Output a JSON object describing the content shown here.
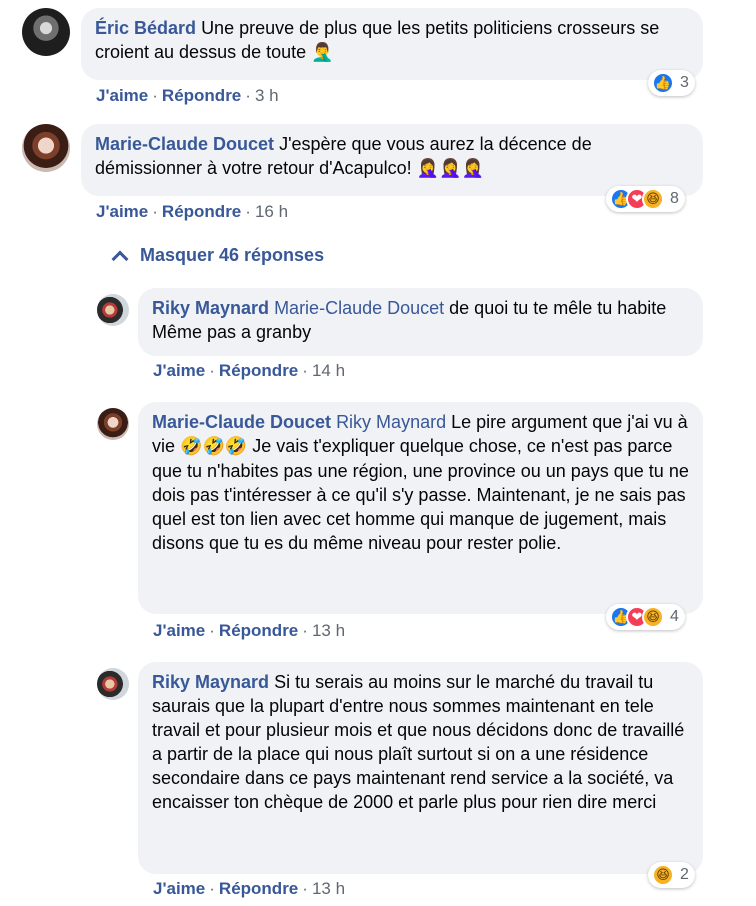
{
  "comments": [
    {
      "author": "Éric Bédard",
      "text": "Une preuve de plus que les petits politiciens crosseurs se croient au dessus de toute",
      "emoji": "🤦‍♂️",
      "like_label": "J'aime",
      "reply_label": "Répondre",
      "time": "3 h",
      "reaction_count": "3"
    },
    {
      "author": "Marie-Claude Doucet",
      "text": "J'espère que vous aurez la décence de démissionner à votre retour d'Acapulco!",
      "emoji": "🤦‍♀️🤦‍♀️🤦‍♀️",
      "like_label": "J'aime",
      "reply_label": "Répondre",
      "time": "16 h",
      "reaction_count": "8"
    }
  ],
  "replies_toggle": "Masquer 46 réponses",
  "replies": [
    {
      "author": "Riky Maynard",
      "mention": "Marie-Claude Doucet",
      "text": "de quoi tu te mêle tu habite Même pas a granby",
      "like_label": "J'aime",
      "reply_label": "Répondre",
      "time": "14 h"
    },
    {
      "author": "Marie-Claude Doucet",
      "mention": "Riky Maynard",
      "text_a": "Le pire argument que j'ai vu à vie",
      "emoji": "🤣🤣🤣",
      "text_b": "Je vais t'expliquer quelque chose, ce n'est pas parce que tu n'habites pas une région, une province ou un pays que tu ne dois pas t'intéresser à ce qu'il s'y passe. Maintenant, je ne sais pas quel est ton lien avec cet homme qui manque de jugement, mais disons que tu es du même niveau pour rester polie.",
      "like_label": "J'aime",
      "reply_label": "Répondre",
      "time": "13 h",
      "reaction_count": "4"
    },
    {
      "author": "Riky Maynard",
      "text": "Si tu serais au moins sur le marché du travail tu saurais que la plupart d'entre nous sommes maintenant en tele travail et pour plusieur mois et que nous décidons donc de travaillé a partir de la place qui nous plaît surtout si on a une résidence secondaire dans ce pays maintenant rend service a la société, va encaisser ton chèque de 2000 et parle plus pour rien dire merci",
      "like_label": "J'aime",
      "reply_label": "Répondre",
      "time": "13 h",
      "reaction_count": "2"
    }
  ],
  "icons": {
    "like": "👍",
    "love": "❤",
    "haha": "😆"
  }
}
